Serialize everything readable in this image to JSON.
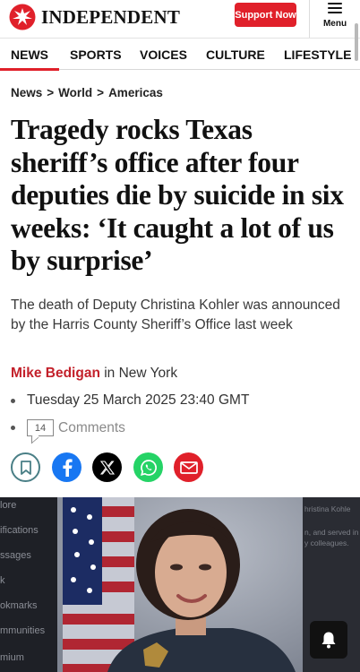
{
  "header": {
    "logo_text": "INDEPENDENT",
    "support_label": "Support Now",
    "menu_label": "Menu"
  },
  "nav": {
    "items": [
      {
        "label": "NEWS",
        "active": true
      },
      {
        "label": "SPORTS",
        "active": false
      },
      {
        "label": "VOICES",
        "active": false
      },
      {
        "label": "CULTURE",
        "active": false
      },
      {
        "label": "LIFESTYLE",
        "active": false
      }
    ]
  },
  "breadcrumb": {
    "items": [
      "News",
      "World",
      "Americas"
    ],
    "separator": ">"
  },
  "article": {
    "headline": "Tragedy rocks Texas sheriff’s office after four deputies die by suicide in six weeks: ‘It caught a lot of us by surprise’",
    "standfirst": "The death of Deputy Christina Kohler was announced by the Harris County Sheriff’s Office last week",
    "author": "Mike Bedigan",
    "location": " in New York",
    "date": "Tuesday 25 March 2025 23:40 GMT",
    "comment_count": "14",
    "comments_label": "Comments"
  },
  "share": {
    "icons": [
      "bookmark-icon",
      "facebook-icon",
      "x-icon",
      "whatsapp-icon",
      "email-icon"
    ]
  },
  "photo": {
    "left_menu": [
      "lore",
      "ifications",
      "ssages",
      "k",
      "okmarks",
      "mmunities",
      "mium"
    ],
    "right_caption": [
      "hristina Kohle",
      "n, and served in",
      "y colleagues."
    ]
  },
  "colors": {
    "brand_red": "#e0202a",
    "author_red": "#c3202a",
    "facebook": "#1877f2",
    "whatsapp": "#25d366",
    "email": "#e0202a"
  }
}
